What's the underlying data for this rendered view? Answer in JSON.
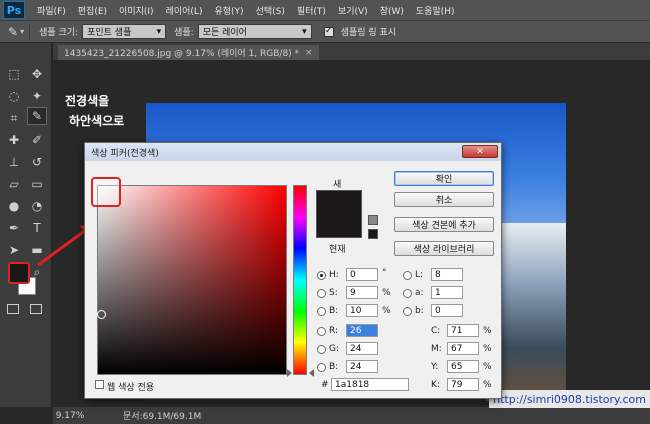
{
  "app": {
    "logo": "Ps"
  },
  "menu": [
    "파일(F)",
    "편집(E)",
    "이미지(I)",
    "레이어(L)",
    "유형(Y)",
    "선택(S)",
    "필터(T)",
    "보기(V)",
    "창(W)",
    "도움말(H)"
  ],
  "options": {
    "sample_size_label": "샘플 크기:",
    "sample_size_value": "포인트 샘플",
    "sample_label": "샘플:",
    "sample_value": "모든 레이어",
    "show_ring_checked": true,
    "show_ring_label": "샘플링 링 표시"
  },
  "document": {
    "tab_title": "1435423_21226508.jpg @ 9.17% (레이어 1, RGB/8) *",
    "tab_close": "×",
    "zoom": "9.17%",
    "doc_info": "문서:69.1M/69.1M"
  },
  "annotation": {
    "line1": "전경색을",
    "line2": "하안색으로"
  },
  "watermark": "http://simri0908.tistory.com",
  "dialog": {
    "title": "색상 피커(전경색)",
    "close_label": "✕",
    "new_label": "새",
    "current_label": "현재",
    "current_color": "#1a1818",
    "buttons": {
      "ok": "확인",
      "cancel": "취소",
      "add_to_swatches": "색상 견본에 추가",
      "color_libraries": "색상 라이브러리"
    },
    "hsb": {
      "h_label": "H:",
      "h_value": "0",
      "h_unit": "°",
      "s_label": "S:",
      "s_value": "9",
      "s_unit": "%",
      "b_label": "B:",
      "b_value": "10",
      "b_unit": "%"
    },
    "rgb": {
      "r_label": "R:",
      "r_value": "26",
      "g_label": "G:",
      "g_value": "24",
      "b_label": "B:",
      "b_value": "24"
    },
    "lab": {
      "l_label": "L:",
      "l_value": "8",
      "a_label": "a:",
      "a_value": "1",
      "b_label": "b:",
      "b_value": "0"
    },
    "cmyk": {
      "c_label": "C:",
      "c_value": "71",
      "c_unit": "%",
      "m_label": "M:",
      "m_value": "67",
      "m_unit": "%",
      "y_label": "Y:",
      "y_value": "65",
      "y_unit": "%",
      "k_label": "K:",
      "k_value": "79",
      "k_unit": "%"
    },
    "hex_label": "#",
    "hex_value": "1a1818",
    "web_only_label": "웹 색상 전용",
    "web_only_checked": false
  },
  "colors": {
    "foreground": "#1a1818",
    "background": "#ffffff",
    "highlight": "#dd2222"
  }
}
